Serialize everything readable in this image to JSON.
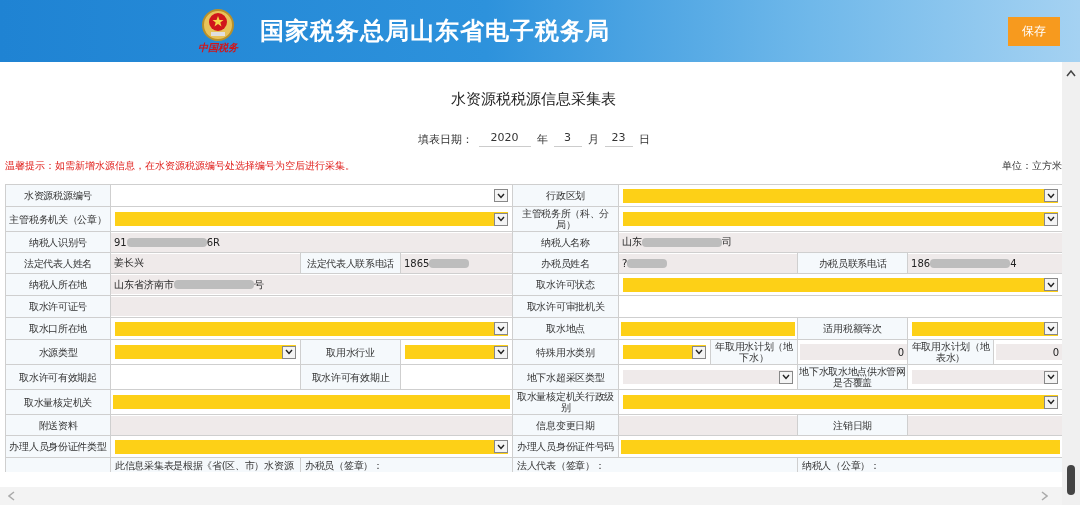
{
  "header": {
    "logo_caption": "中国税务",
    "title": "国家税务总局山东省电子税务局",
    "save_button": "保存"
  },
  "form": {
    "title": "水资源税税源信息采集表",
    "date": {
      "label": "填表日期：",
      "year": "2020",
      "year_unit": "年",
      "month": "3",
      "month_unit": "月",
      "day": "23",
      "day_unit": "日"
    },
    "tip": "温馨提示：如需新增水源信息，在水资源税源编号处选择编号为空后进行采集。",
    "unit": "单位：立方米"
  },
  "rows": [
    [
      {
        "kind": "label",
        "text": "水资源税源编号"
      },
      {
        "kind": "select",
        "required": false,
        "disabled": false
      },
      {
        "kind": "label",
        "text": "行政区划"
      },
      {
        "kind": "select",
        "required": true,
        "disabled": false
      }
    ],
    [
      {
        "kind": "label",
        "text": "主管税务机关（公章）"
      },
      {
        "kind": "select",
        "required": true,
        "disabled": false
      },
      {
        "kind": "label",
        "text": "主管税务所（科、分局）"
      },
      {
        "kind": "select",
        "required": true,
        "disabled": false
      }
    ],
    [
      {
        "kind": "label",
        "text": "纳税人识别号"
      },
      {
        "kind": "input",
        "readonly": true,
        "value": "91",
        "redacted": true,
        "value_end": "6R"
      },
      {
        "kind": "label",
        "text": "纳税人名称"
      },
      {
        "kind": "input",
        "readonly": true,
        "value": "山东",
        "redacted": true,
        "value_end": "司"
      }
    ],
    [
      {
        "kind": "label",
        "text": "法定代表人姓名"
      },
      {
        "kind": "input",
        "readonly": true,
        "value": "姜长兴",
        "redacted": false
      },
      {
        "kind": "label",
        "text": "法定代表人联系电话"
      },
      {
        "kind": "input",
        "readonly": true,
        "value": "1865",
        "redacted": true
      },
      {
        "kind": "label",
        "text": "办税员姓名"
      },
      {
        "kind": "input",
        "readonly": true,
        "value": "?",
        "redacted": true
      },
      {
        "kind": "label",
        "text": "办税员联系电话"
      },
      {
        "kind": "input",
        "readonly": true,
        "value": "186",
        "redacted": true,
        "value_end": "4"
      }
    ],
    [
      {
        "kind": "label",
        "text": "纳税人所在地"
      },
      {
        "kind": "input",
        "readonly": true,
        "value": "山东省济南市",
        "redacted": true,
        "value_end": "号"
      },
      {
        "kind": "label",
        "text": "取水许可状态"
      },
      {
        "kind": "select",
        "required": true,
        "disabled": false
      }
    ],
    [
      {
        "kind": "label",
        "text": "取水许可证号"
      },
      {
        "kind": "input",
        "readonly": true
      },
      {
        "kind": "label",
        "text": "取水许可审批机关"
      },
      {
        "kind": "input",
        "required": false,
        "readonly": false
      }
    ],
    [
      {
        "kind": "label",
        "text": "取水口所在地"
      },
      {
        "kind": "select",
        "required": true,
        "disabled": false
      },
      {
        "kind": "label",
        "text": "取水地点"
      },
      {
        "kind": "input",
        "required": true,
        "readonly": false
      },
      {
        "kind": "label",
        "text": "适用税额等次"
      },
      {
        "kind": "select",
        "required": true,
        "disabled": false
      }
    ],
    [
      {
        "kind": "label",
        "text": "水源类型"
      },
      {
        "kind": "select",
        "required": true,
        "disabled": false
      },
      {
        "kind": "label",
        "text": "取用水行业"
      },
      {
        "kind": "select",
        "required": true,
        "disabled": false
      },
      {
        "kind": "label",
        "text": "特殊用水类别"
      },
      {
        "kind": "select",
        "required": true,
        "disabled": false
      },
      {
        "kind": "label",
        "text": "年取用水计划（地下水）"
      },
      {
        "kind": "number",
        "readonly": true,
        "value": "0"
      },
      {
        "kind": "label",
        "text": "年取用水计划（地表水）"
      },
      {
        "kind": "number",
        "readonly": true,
        "value": "0"
      }
    ],
    [
      {
        "kind": "label",
        "text": "取水许可有效期起"
      },
      {
        "kind": "input",
        "required": false,
        "readonly": false
      },
      {
        "kind": "label",
        "text": "取水许可有效期止"
      },
      {
        "kind": "input",
        "required": false,
        "readonly": false
      },
      {
        "kind": "label",
        "text": "地下水超采区类型"
      },
      {
        "kind": "select",
        "disabled": true
      },
      {
        "kind": "label",
        "text": "地下水取水地点供水管网是否覆盖"
      },
      {
        "kind": "select",
        "disabled": true
      }
    ],
    [
      {
        "kind": "label",
        "text": "取水量核定机关"
      },
      {
        "kind": "input",
        "required": true,
        "readonly": false
      },
      {
        "kind": "label",
        "text": "取水量核定机关行政级别"
      },
      {
        "kind": "select",
        "required": true,
        "disabled": false
      }
    ],
    [
      {
        "kind": "label",
        "text": "附送资料"
      },
      {
        "kind": "input",
        "readonly": true
      },
      {
        "kind": "label",
        "text": "信息变更日期"
      },
      {
        "kind": "input",
        "readonly": true
      },
      {
        "kind": "label",
        "text": "注销日期"
      },
      {
        "kind": "input",
        "readonly": true
      }
    ],
    [
      {
        "kind": "label",
        "text": "办理人员身份证件类型"
      },
      {
        "kind": "select",
        "required": true,
        "disabled": false
      },
      {
        "kind": "label",
        "text": "办理人员身份证件号码"
      },
      {
        "kind": "input",
        "required": true,
        "readonly": false
      }
    ],
    [
      {
        "kind": "blank"
      },
      {
        "kind": "note",
        "text": "此信息采集表是根据《省(区、市）水资源"
      },
      {
        "kind": "note",
        "text": "办税员（签章）："
      },
      {
        "kind": "note",
        "text": "法人代表（签章）："
      },
      {
        "kind": "note",
        "text": "纳税人（公章）："
      }
    ]
  ]
}
